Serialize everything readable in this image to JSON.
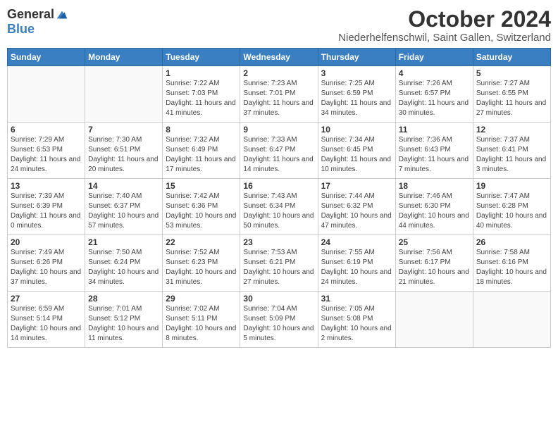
{
  "header": {
    "logo_general": "General",
    "logo_blue": "Blue",
    "month_title": "October 2024",
    "location": "Niederhelfenschwil, Saint Gallen, Switzerland"
  },
  "calendar": {
    "days_of_week": [
      "Sunday",
      "Monday",
      "Tuesday",
      "Wednesday",
      "Thursday",
      "Friday",
      "Saturday"
    ],
    "weeks": [
      [
        {
          "day": "",
          "info": ""
        },
        {
          "day": "",
          "info": ""
        },
        {
          "day": "1",
          "info": "Sunrise: 7:22 AM\nSunset: 7:03 PM\nDaylight: 11 hours and 41 minutes."
        },
        {
          "day": "2",
          "info": "Sunrise: 7:23 AM\nSunset: 7:01 PM\nDaylight: 11 hours and 37 minutes."
        },
        {
          "day": "3",
          "info": "Sunrise: 7:25 AM\nSunset: 6:59 PM\nDaylight: 11 hours and 34 minutes."
        },
        {
          "day": "4",
          "info": "Sunrise: 7:26 AM\nSunset: 6:57 PM\nDaylight: 11 hours and 30 minutes."
        },
        {
          "day": "5",
          "info": "Sunrise: 7:27 AM\nSunset: 6:55 PM\nDaylight: 11 hours and 27 minutes."
        }
      ],
      [
        {
          "day": "6",
          "info": "Sunrise: 7:29 AM\nSunset: 6:53 PM\nDaylight: 11 hours and 24 minutes."
        },
        {
          "day": "7",
          "info": "Sunrise: 7:30 AM\nSunset: 6:51 PM\nDaylight: 11 hours and 20 minutes."
        },
        {
          "day": "8",
          "info": "Sunrise: 7:32 AM\nSunset: 6:49 PM\nDaylight: 11 hours and 17 minutes."
        },
        {
          "day": "9",
          "info": "Sunrise: 7:33 AM\nSunset: 6:47 PM\nDaylight: 11 hours and 14 minutes."
        },
        {
          "day": "10",
          "info": "Sunrise: 7:34 AM\nSunset: 6:45 PM\nDaylight: 11 hours and 10 minutes."
        },
        {
          "day": "11",
          "info": "Sunrise: 7:36 AM\nSunset: 6:43 PM\nDaylight: 11 hours and 7 minutes."
        },
        {
          "day": "12",
          "info": "Sunrise: 7:37 AM\nSunset: 6:41 PM\nDaylight: 11 hours and 3 minutes."
        }
      ],
      [
        {
          "day": "13",
          "info": "Sunrise: 7:39 AM\nSunset: 6:39 PM\nDaylight: 11 hours and 0 minutes."
        },
        {
          "day": "14",
          "info": "Sunrise: 7:40 AM\nSunset: 6:37 PM\nDaylight: 10 hours and 57 minutes."
        },
        {
          "day": "15",
          "info": "Sunrise: 7:42 AM\nSunset: 6:36 PM\nDaylight: 10 hours and 53 minutes."
        },
        {
          "day": "16",
          "info": "Sunrise: 7:43 AM\nSunset: 6:34 PM\nDaylight: 10 hours and 50 minutes."
        },
        {
          "day": "17",
          "info": "Sunrise: 7:44 AM\nSunset: 6:32 PM\nDaylight: 10 hours and 47 minutes."
        },
        {
          "day": "18",
          "info": "Sunrise: 7:46 AM\nSunset: 6:30 PM\nDaylight: 10 hours and 44 minutes."
        },
        {
          "day": "19",
          "info": "Sunrise: 7:47 AM\nSunset: 6:28 PM\nDaylight: 10 hours and 40 minutes."
        }
      ],
      [
        {
          "day": "20",
          "info": "Sunrise: 7:49 AM\nSunset: 6:26 PM\nDaylight: 10 hours and 37 minutes."
        },
        {
          "day": "21",
          "info": "Sunrise: 7:50 AM\nSunset: 6:24 PM\nDaylight: 10 hours and 34 minutes."
        },
        {
          "day": "22",
          "info": "Sunrise: 7:52 AM\nSunset: 6:23 PM\nDaylight: 10 hours and 31 minutes."
        },
        {
          "day": "23",
          "info": "Sunrise: 7:53 AM\nSunset: 6:21 PM\nDaylight: 10 hours and 27 minutes."
        },
        {
          "day": "24",
          "info": "Sunrise: 7:55 AM\nSunset: 6:19 PM\nDaylight: 10 hours and 24 minutes."
        },
        {
          "day": "25",
          "info": "Sunrise: 7:56 AM\nSunset: 6:17 PM\nDaylight: 10 hours and 21 minutes."
        },
        {
          "day": "26",
          "info": "Sunrise: 7:58 AM\nSunset: 6:16 PM\nDaylight: 10 hours and 18 minutes."
        }
      ],
      [
        {
          "day": "27",
          "info": "Sunrise: 6:59 AM\nSunset: 5:14 PM\nDaylight: 10 hours and 14 minutes."
        },
        {
          "day": "28",
          "info": "Sunrise: 7:01 AM\nSunset: 5:12 PM\nDaylight: 10 hours and 11 minutes."
        },
        {
          "day": "29",
          "info": "Sunrise: 7:02 AM\nSunset: 5:11 PM\nDaylight: 10 hours and 8 minutes."
        },
        {
          "day": "30",
          "info": "Sunrise: 7:04 AM\nSunset: 5:09 PM\nDaylight: 10 hours and 5 minutes."
        },
        {
          "day": "31",
          "info": "Sunrise: 7:05 AM\nSunset: 5:08 PM\nDaylight: 10 hours and 2 minutes."
        },
        {
          "day": "",
          "info": ""
        },
        {
          "day": "",
          "info": ""
        }
      ]
    ]
  }
}
